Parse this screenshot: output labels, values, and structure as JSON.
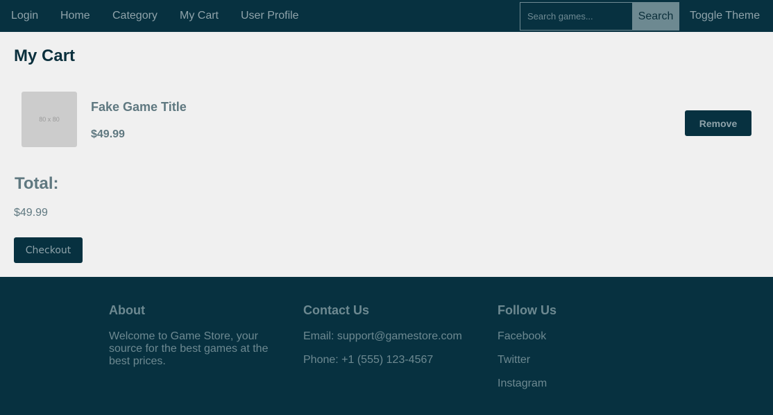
{
  "nav": {
    "links": [
      "Login",
      "Home",
      "Category",
      "My Cart",
      "User Profile"
    ],
    "search_placeholder": "Search games...",
    "search_label": "Search",
    "toggle_theme": "Toggle Theme"
  },
  "cart": {
    "title": "My Cart",
    "items": [
      {
        "thumbnail_label": "80 x 80",
        "title": "Fake Game Title",
        "price": "$49.99",
        "remove_label": "Remove"
      }
    ],
    "total_label": "Total:",
    "total_value": "$49.99",
    "checkout_label": "Checkout"
  },
  "footer": {
    "about": {
      "heading": "About",
      "text": "Welcome to Game Store, your source for the best games at the best prices."
    },
    "contact": {
      "heading": "Contact Us",
      "email": "Email: support@gamestore.com",
      "phone": "Phone: +1 (555) 123-4567"
    },
    "follow": {
      "heading": "Follow Us",
      "links": [
        "Facebook",
        "Twitter",
        "Instagram"
      ]
    }
  },
  "colors": {
    "navbar_bg": "#073140",
    "page_bg": "#f0f0f0",
    "muted_text": "#5f7880",
    "button_bg": "#073140"
  }
}
